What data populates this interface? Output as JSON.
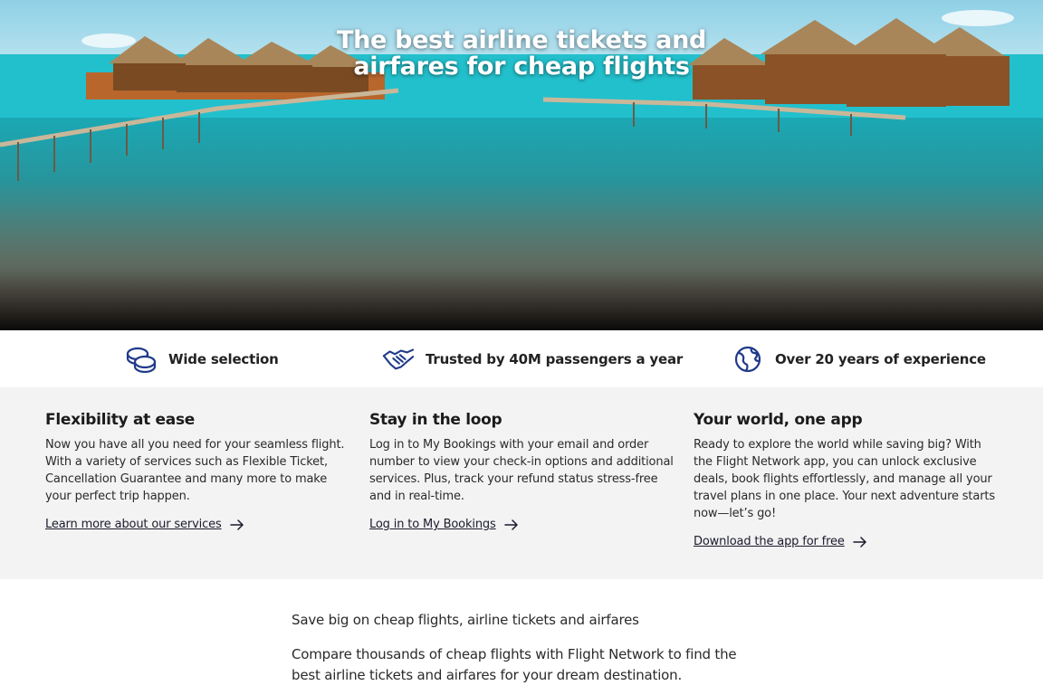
{
  "hero": {
    "title_line1": "The best airline tickets and",
    "title_line2": "airfares for cheap flights",
    "image": "tropical-overwater-bungalows"
  },
  "features": [
    {
      "icon": "coins-icon",
      "label": "Wide selection"
    },
    {
      "icon": "handshake-icon",
      "label": "Trusted by 40M passengers a year"
    },
    {
      "icon": "globe-icon",
      "label": "Over 20 years of experience"
    }
  ],
  "info": [
    {
      "title": "Flexibility at ease",
      "body": "Now you have all you need for your seamless flight. With a variety of services such as Flexible Ticket, Cancellation Guarantee and many more to make your perfect trip happen.",
      "link": "Learn more about our services"
    },
    {
      "title": "Stay in the loop",
      "body": "Log in to My Bookings with your email and order number to view your check-in options and additional services. Plus, track your refund status stress-free and in real-time.",
      "link": "Log in to My Bookings"
    },
    {
      "title": "Your world, one app",
      "body": "Ready to explore the world while saving big? With the Flight Network app, you can unlock exclusive deals, book flights effortlessly, and manage all your travel plans in one place. Your next adventure starts now—let’s go!",
      "link": "Download the app for free"
    }
  ],
  "bottom": {
    "lead": "Save big on cheap flights, airline tickets and airfares",
    "description": "Compare thousands of cheap flights with Flight Network to find the best airline tickets and airfares for your dream destination."
  },
  "colors": {
    "accent_blue": "#1f3a8a",
    "section_bg": "#f3f3f3",
    "sea": "#1fb5c4"
  }
}
